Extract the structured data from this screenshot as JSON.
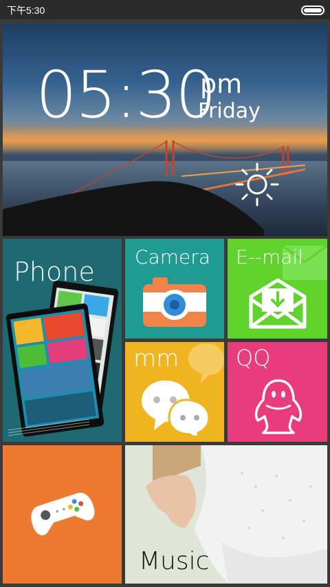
{
  "status_bar": {
    "time": "下午5:30",
    "battery_level": 1.0
  },
  "clock": {
    "time": "05:30",
    "ampm": "pm",
    "day": "Friday",
    "weather_icon": "sun-icon"
  },
  "tiles": {
    "phone": {
      "label": "Phone",
      "color": "#1f6a72"
    },
    "camera": {
      "label": "Camera",
      "color": "#1f9b91",
      "icon": "camera-icon"
    },
    "email": {
      "label": "E--mail",
      "color": "#5fd22c",
      "icon": "mail-download-icon"
    },
    "mm": {
      "label": "mm",
      "color": "#f0b420",
      "icon": "chat-bubble-icon"
    },
    "qq": {
      "label": "QQ",
      "color": "#e83c7d",
      "icon": "penguin-icon"
    },
    "game": {
      "color": "#ed7a30",
      "icon": "gamepad-icon"
    },
    "music": {
      "label": "Music"
    }
  }
}
